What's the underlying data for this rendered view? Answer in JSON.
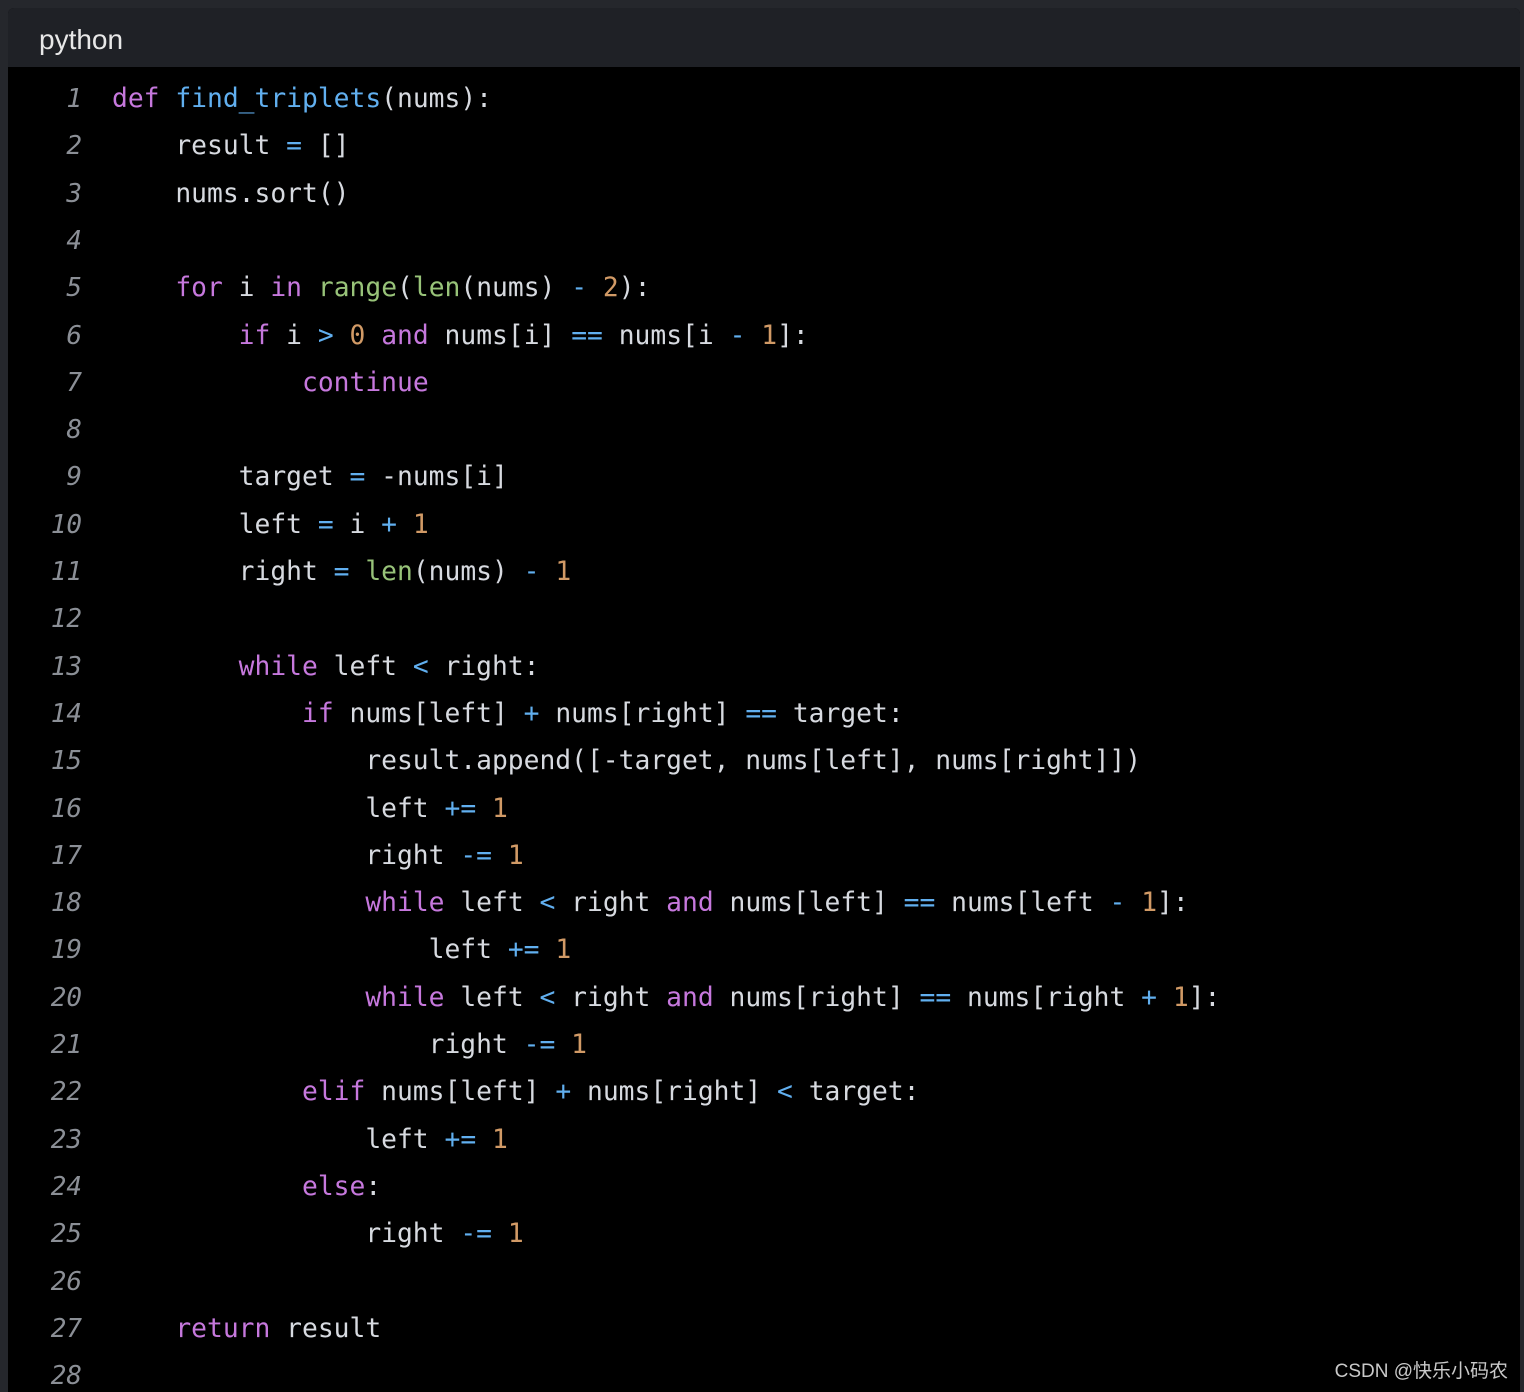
{
  "header": {
    "language": "python"
  },
  "watermark": "CSDN @快乐小码农",
  "colors": {
    "text": "#d7dae0",
    "keyword": "#c678dd",
    "function": "#61afef",
    "builtin": "#98c379",
    "number": "#d19a66",
    "operator": "#61afef",
    "line_number": "#8b8f96",
    "background": "#000000",
    "header_bg": "#1f2126"
  },
  "code_lines": [
    {
      "num": "1",
      "tokens": [
        [
          "kw",
          "def"
        ],
        [
          "t",
          " "
        ],
        [
          "fn",
          "find_triplets"
        ],
        [
          "t",
          "(nums):"
        ]
      ]
    },
    {
      "num": "2",
      "tokens": [
        [
          "t",
          "    result "
        ],
        [
          "op",
          "="
        ],
        [
          "t",
          " []"
        ]
      ]
    },
    {
      "num": "3",
      "tokens": [
        [
          "t",
          "    nums.sort()"
        ]
      ]
    },
    {
      "num": "4",
      "tokens": []
    },
    {
      "num": "5",
      "tokens": [
        [
          "t",
          "    "
        ],
        [
          "kw",
          "for"
        ],
        [
          "t",
          " i "
        ],
        [
          "kw",
          "in"
        ],
        [
          "t",
          " "
        ],
        [
          "bi",
          "range"
        ],
        [
          "t",
          "("
        ],
        [
          "bi",
          "len"
        ],
        [
          "t",
          "(nums) "
        ],
        [
          "op",
          "-"
        ],
        [
          "t",
          " "
        ],
        [
          "nm",
          "2"
        ],
        [
          "t",
          "):"
        ]
      ]
    },
    {
      "num": "6",
      "tokens": [
        [
          "t",
          "        "
        ],
        [
          "kw",
          "if"
        ],
        [
          "t",
          " i "
        ],
        [
          "op",
          ">"
        ],
        [
          "t",
          " "
        ],
        [
          "nm",
          "0"
        ],
        [
          "t",
          " "
        ],
        [
          "kw",
          "and"
        ],
        [
          "t",
          " nums[i] "
        ],
        [
          "op",
          "=="
        ],
        [
          "t",
          " nums[i "
        ],
        [
          "op",
          "-"
        ],
        [
          "t",
          " "
        ],
        [
          "nm",
          "1"
        ],
        [
          "t",
          "]:"
        ]
      ]
    },
    {
      "num": "7",
      "tokens": [
        [
          "t",
          "            "
        ],
        [
          "kw",
          "continue"
        ]
      ]
    },
    {
      "num": "8",
      "tokens": []
    },
    {
      "num": "9",
      "tokens": [
        [
          "t",
          "        target "
        ],
        [
          "op",
          "="
        ],
        [
          "t",
          " -nums[i]"
        ]
      ]
    },
    {
      "num": "10",
      "tokens": [
        [
          "t",
          "        left "
        ],
        [
          "op",
          "="
        ],
        [
          "t",
          " i "
        ],
        [
          "op",
          "+"
        ],
        [
          "t",
          " "
        ],
        [
          "nm",
          "1"
        ]
      ]
    },
    {
      "num": "11",
      "tokens": [
        [
          "t",
          "        right "
        ],
        [
          "op",
          "="
        ],
        [
          "t",
          " "
        ],
        [
          "bi",
          "len"
        ],
        [
          "t",
          "(nums) "
        ],
        [
          "op",
          "-"
        ],
        [
          "t",
          " "
        ],
        [
          "nm",
          "1"
        ]
      ]
    },
    {
      "num": "12",
      "tokens": []
    },
    {
      "num": "13",
      "tokens": [
        [
          "t",
          "        "
        ],
        [
          "kw",
          "while"
        ],
        [
          "t",
          " left "
        ],
        [
          "op",
          "<"
        ],
        [
          "t",
          " right:"
        ]
      ]
    },
    {
      "num": "14",
      "tokens": [
        [
          "t",
          "            "
        ],
        [
          "kw",
          "if"
        ],
        [
          "t",
          " nums[left] "
        ],
        [
          "op",
          "+"
        ],
        [
          "t",
          " nums[right] "
        ],
        [
          "op",
          "=="
        ],
        [
          "t",
          " target:"
        ]
      ]
    },
    {
      "num": "15",
      "tokens": [
        [
          "t",
          "                result.append([-target, nums[left], nums[right]])"
        ]
      ]
    },
    {
      "num": "16",
      "tokens": [
        [
          "t",
          "                left "
        ],
        [
          "op",
          "+="
        ],
        [
          "t",
          " "
        ],
        [
          "nm",
          "1"
        ]
      ]
    },
    {
      "num": "17",
      "tokens": [
        [
          "t",
          "                right "
        ],
        [
          "op",
          "-="
        ],
        [
          "t",
          " "
        ],
        [
          "nm",
          "1"
        ]
      ]
    },
    {
      "num": "18",
      "tokens": [
        [
          "t",
          "                "
        ],
        [
          "kw",
          "while"
        ],
        [
          "t",
          " left "
        ],
        [
          "op",
          "<"
        ],
        [
          "t",
          " right "
        ],
        [
          "kw",
          "and"
        ],
        [
          "t",
          " nums[left] "
        ],
        [
          "op",
          "=="
        ],
        [
          "t",
          " nums[left "
        ],
        [
          "op",
          "-"
        ],
        [
          "t",
          " "
        ],
        [
          "nm",
          "1"
        ],
        [
          "t",
          "]:"
        ]
      ]
    },
    {
      "num": "19",
      "tokens": [
        [
          "t",
          "                    left "
        ],
        [
          "op",
          "+="
        ],
        [
          "t",
          " "
        ],
        [
          "nm",
          "1"
        ]
      ]
    },
    {
      "num": "20",
      "tokens": [
        [
          "t",
          "                "
        ],
        [
          "kw",
          "while"
        ],
        [
          "t",
          " left "
        ],
        [
          "op",
          "<"
        ],
        [
          "t",
          " right "
        ],
        [
          "kw",
          "and"
        ],
        [
          "t",
          " nums[right] "
        ],
        [
          "op",
          "=="
        ],
        [
          "t",
          " nums[right "
        ],
        [
          "op",
          "+"
        ],
        [
          "t",
          " "
        ],
        [
          "nm",
          "1"
        ],
        [
          "t",
          "]:"
        ]
      ]
    },
    {
      "num": "21",
      "tokens": [
        [
          "t",
          "                    right "
        ],
        [
          "op",
          "-="
        ],
        [
          "t",
          " "
        ],
        [
          "nm",
          "1"
        ]
      ]
    },
    {
      "num": "22",
      "tokens": [
        [
          "t",
          "            "
        ],
        [
          "kw",
          "elif"
        ],
        [
          "t",
          " nums[left] "
        ],
        [
          "op",
          "+"
        ],
        [
          "t",
          " nums[right] "
        ],
        [
          "op",
          "<"
        ],
        [
          "t",
          " target:"
        ]
      ]
    },
    {
      "num": "23",
      "tokens": [
        [
          "t",
          "                left "
        ],
        [
          "op",
          "+="
        ],
        [
          "t",
          " "
        ],
        [
          "nm",
          "1"
        ]
      ]
    },
    {
      "num": "24",
      "tokens": [
        [
          "t",
          "            "
        ],
        [
          "kw",
          "else"
        ],
        [
          "t",
          ":"
        ]
      ]
    },
    {
      "num": "25",
      "tokens": [
        [
          "t",
          "                right "
        ],
        [
          "op",
          "-="
        ],
        [
          "t",
          " "
        ],
        [
          "nm",
          "1"
        ]
      ]
    },
    {
      "num": "26",
      "tokens": []
    },
    {
      "num": "27",
      "tokens": [
        [
          "t",
          "    "
        ],
        [
          "kw",
          "return"
        ],
        [
          "t",
          " result"
        ]
      ]
    },
    {
      "num": "28",
      "tokens": []
    }
  ]
}
